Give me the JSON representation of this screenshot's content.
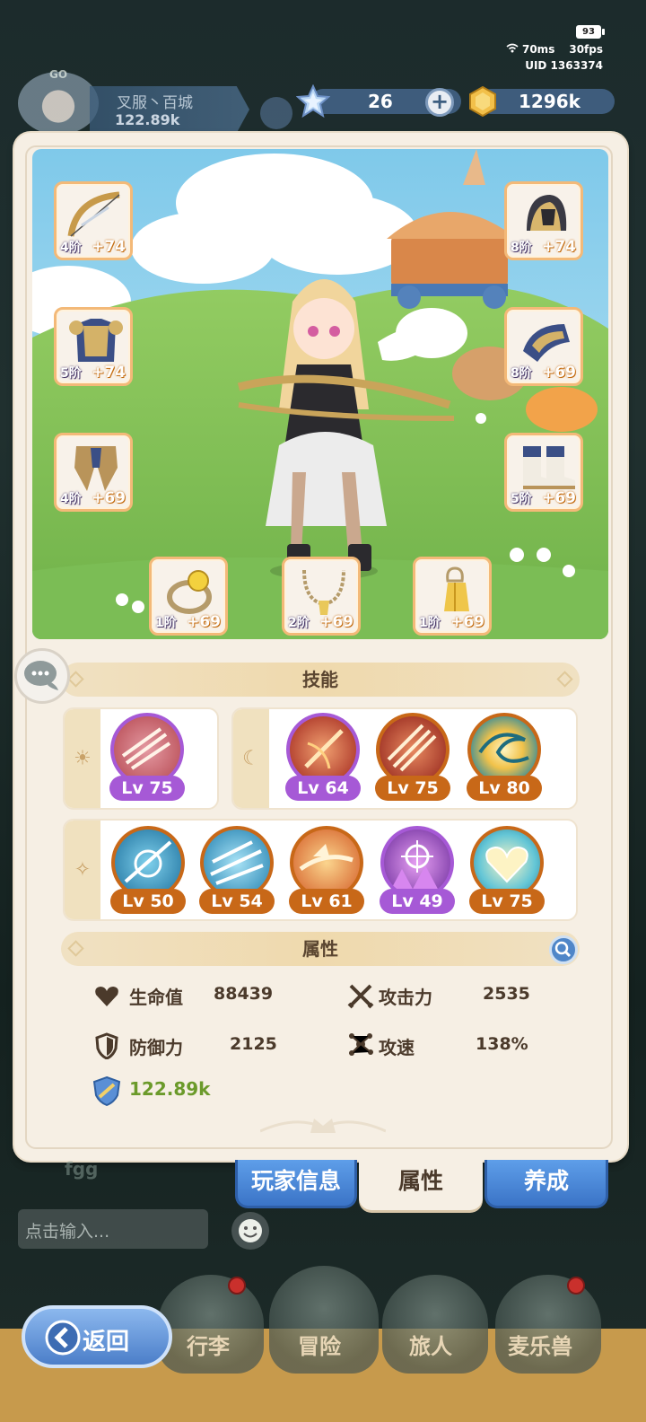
{
  "status": {
    "battery": "93",
    "ping": "70ms",
    "fps": "30fps",
    "uid": "UID 1363374"
  },
  "guild": {
    "logo_text": "GO",
    "name": "叉服丶百城",
    "power": "122.89k"
  },
  "resources": {
    "stars": "26",
    "gold": "1296k"
  },
  "equipment": [
    {
      "slot": "weapon",
      "icon": "bow-icon",
      "tier": "4阶",
      "enhance": "+74"
    },
    {
      "slot": "armor",
      "icon": "chestplate-icon",
      "tier": "5阶",
      "enhance": "+74"
    },
    {
      "slot": "pants",
      "icon": "leg-armor-icon",
      "tier": "4阶",
      "enhance": "+69"
    },
    {
      "slot": "helmet",
      "icon": "helmet-icon",
      "tier": "8阶",
      "enhance": "+74"
    },
    {
      "slot": "gloves",
      "icon": "gauntlet-icon",
      "tier": "8阶",
      "enhance": "+69"
    },
    {
      "slot": "boots",
      "icon": "boots-icon",
      "tier": "5阶",
      "enhance": "+69"
    },
    {
      "slot": "ring",
      "icon": "ring-icon",
      "tier": "1阶",
      "enhance": "+69"
    },
    {
      "slot": "necklace",
      "icon": "necklace-icon",
      "tier": "2阶",
      "enhance": "+69"
    },
    {
      "slot": "pendant",
      "icon": "pendant-icon",
      "tier": "1阶",
      "enhance": "+69"
    }
  ],
  "skills": {
    "title": "技能",
    "sun_row": [
      {
        "icon": "multi-arrow-icon",
        "lv": "Lv 75",
        "rarity": "purple"
      }
    ],
    "moon_row": [
      {
        "icon": "fire-arrow-icon",
        "lv": "Lv 64",
        "rarity": "purple"
      },
      {
        "icon": "triple-arrow-icon",
        "lv": "Lv 75",
        "rarity": "orange"
      },
      {
        "icon": "vortex-icon",
        "lv": "Lv 80",
        "rarity": "orange"
      }
    ],
    "star_row": [
      {
        "icon": "arrow-break-icon",
        "lv": "Lv 50",
        "rarity": "orange"
      },
      {
        "icon": "wind-arrows-icon",
        "lv": "Lv 54",
        "rarity": "orange"
      },
      {
        "icon": "phoenix-arrow-icon",
        "lv": "Lv 61",
        "rarity": "orange"
      },
      {
        "icon": "target-icon",
        "lv": "Lv 49",
        "rarity": "purple"
      },
      {
        "icon": "heart-icon",
        "lv": "Lv 75",
        "rarity": "orange"
      }
    ]
  },
  "attributes": {
    "title": "属性",
    "hp_label": "生命值",
    "hp": "88439",
    "atk_label": "攻击力",
    "atk": "2535",
    "def_label": "防御力",
    "def": "2125",
    "spd_label": "攻速",
    "spd": "138%",
    "power": "122.89k"
  },
  "tabs": {
    "player_info": "玩家信息",
    "attributes": "属性",
    "develop": "养成"
  },
  "chat": {
    "sender": "fgg",
    "placeholder": "点击输入..."
  },
  "nav": {
    "back": "返回",
    "bag": "行李",
    "adventure": "冒险",
    "travelers": "旅人",
    "pets": "麦乐兽"
  },
  "colors": {
    "accent_blue": "#4b7ec9",
    "purple_level": "#a659d6",
    "orange_level": "#c86818",
    "power_green": "#6b9a2a"
  }
}
